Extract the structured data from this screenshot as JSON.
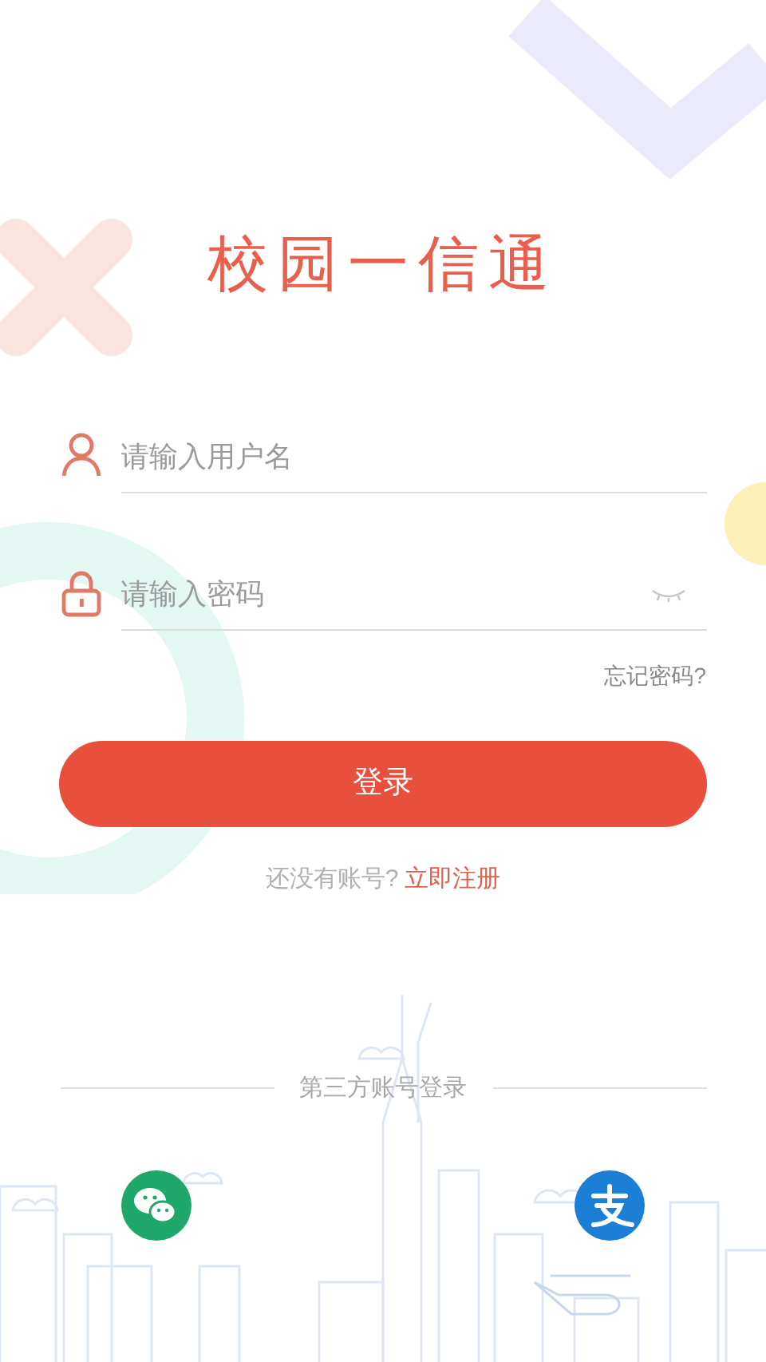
{
  "title": "校园一信通",
  "username_field": {
    "placeholder": "请输入用户名"
  },
  "password_field": {
    "placeholder": "请输入密码",
    "visible": false
  },
  "forgot_link": "忘记密码?",
  "login_button": "登录",
  "register": {
    "prompt": "还没有账号?",
    "link": "立即注册"
  },
  "third_party": {
    "label": "第三方账号登录",
    "providers": [
      {
        "kind": "wechat"
      },
      {
        "kind": "alipay"
      }
    ]
  }
}
